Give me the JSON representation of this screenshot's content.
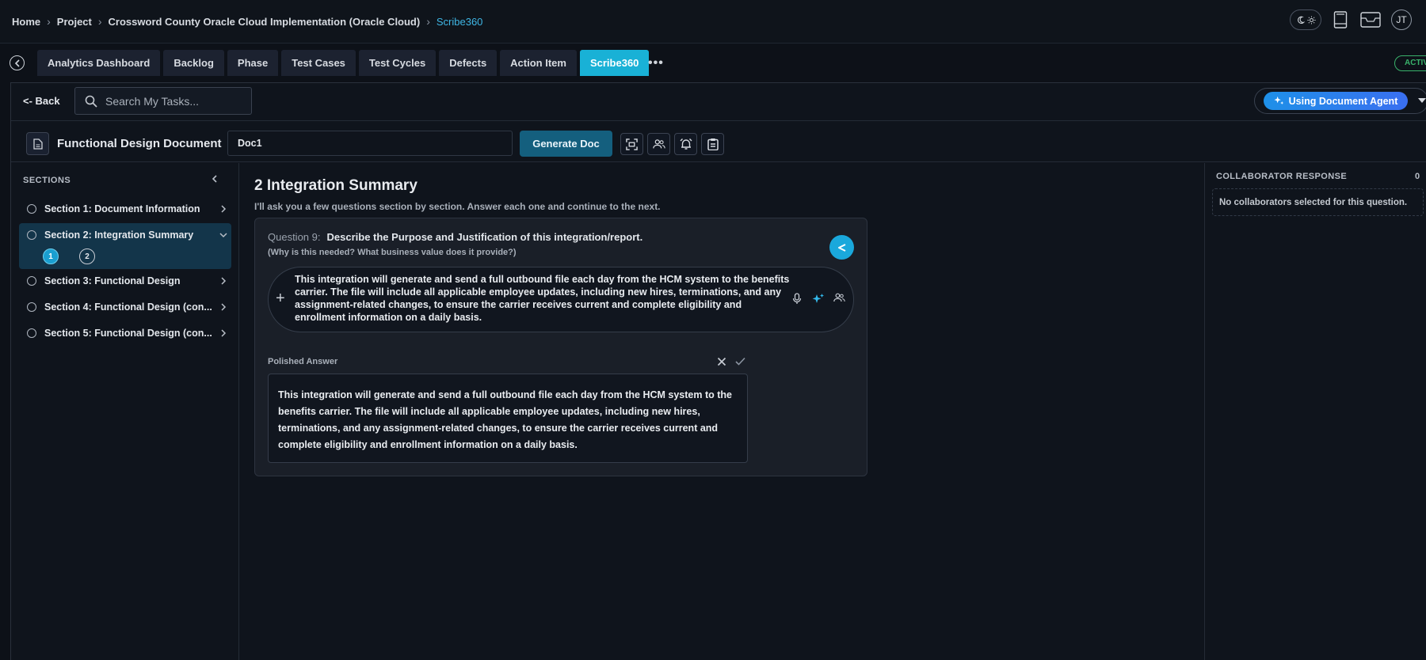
{
  "breadcrumb": {
    "items": [
      "Home",
      "Project",
      "Crossword County Oracle Cloud Implementation (Oracle Cloud)"
    ],
    "current": "Scribe360"
  },
  "user": {
    "initials": "JT"
  },
  "icons": {
    "theme": "moon-sun-toggle-icon",
    "book": "book-icon",
    "inbox": "inbox-icon",
    "back": "chevron-left-circle-icon",
    "search": "search-icon",
    "sparkle": "sparkle-icon",
    "document": "document-icon",
    "screenshot": "scan-icon",
    "users": "users-icon",
    "alarm": "alarm-icon",
    "clipboard": "clipboard-icon",
    "send": "send-icon",
    "mic": "microphone-icon"
  },
  "tabs": [
    {
      "label": "Analytics Dashboard"
    },
    {
      "label": "Backlog"
    },
    {
      "label": "Phase"
    },
    {
      "label": "Test Cases"
    },
    {
      "label": "Test Cycles"
    },
    {
      "label": "Defects"
    },
    {
      "label": "Action Item"
    },
    {
      "label": "Scribe360",
      "active": true
    }
  ],
  "more_label": "•••",
  "status_label": "ACTIVE",
  "subheader": {
    "back_label": "<- Back",
    "search_placeholder": "Search My Tasks...",
    "agent_label": "Using Document Agent"
  },
  "doc_toolbar": {
    "title": "Functional Design Document",
    "doc_name": "Doc1",
    "generate_label": "Generate Doc"
  },
  "sidebar": {
    "title": "SECTIONS",
    "sections": [
      {
        "label": "Section 1: Document Information"
      },
      {
        "label": "Section 2: Integration Summary",
        "expanded": true,
        "steps": [
          "1",
          "2"
        ]
      },
      {
        "label": "Section 3: Functional Design"
      },
      {
        "label": "Section 4: Functional Design (con..."
      },
      {
        "label": "Section 5: Functional Design (con..."
      }
    ]
  },
  "main": {
    "heading": "2 Integration Summary",
    "intro": "I'll ask you a few questions section by section. Answer each one and continue to the next.",
    "question": {
      "number": "Question 9:",
      "text": "Describe the Purpose and Justification of this integration/report.",
      "hint": "(Why is this needed? What business value does it provide?)",
      "answer": "This integration will generate and send a full outbound file each day from the HCM system to the benefits carrier. The file will include all applicable employee updates, including new hires, terminations, and any assignment-related changes, to ensure the carrier receives current and complete eligibility and enrollment information on a daily basis."
    },
    "polished": {
      "label": "Polished Answer",
      "text": "This integration will generate and send a full outbound file each day from the HCM system to the benefits carrier. The file will include all applicable employee updates, including new hires, terminations, and any assignment-related changes, to ensure the carrier receives current and complete eligibility and enrollment information on a daily basis."
    }
  },
  "collaborators": {
    "title": "COLLABORATOR RESPONSE",
    "count": "0",
    "empty_text": "No collaborators selected for this question."
  },
  "colors": {
    "accent": "#19b1d6",
    "background": "#0d1118",
    "panel": "#1a1f28",
    "active_section": "#13354a",
    "generate_button": "#145f7e",
    "status_green": "#39b26b"
  }
}
